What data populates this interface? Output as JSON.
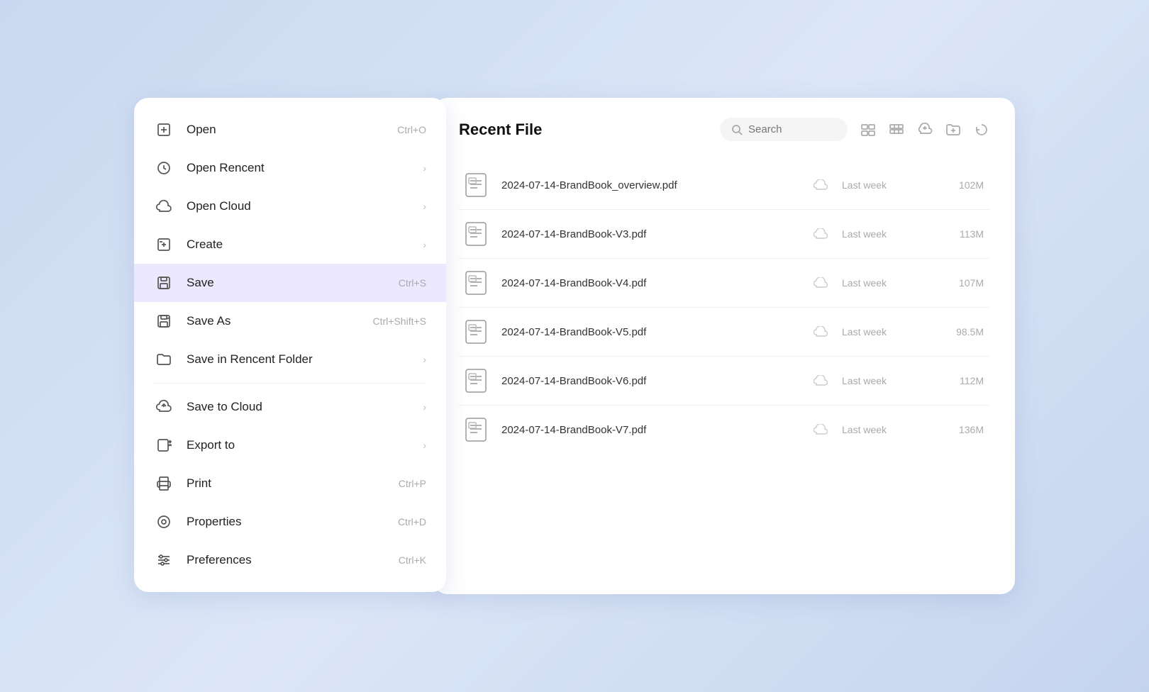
{
  "menu": {
    "items": [
      {
        "id": "open",
        "label": "Open",
        "shortcut": "Ctrl+O",
        "icon": "open-icon",
        "hasArrow": false,
        "active": false
      },
      {
        "id": "open-recent",
        "label": "Open Rencent",
        "shortcut": "",
        "icon": "recent-icon",
        "hasArrow": true,
        "active": false
      },
      {
        "id": "open-cloud",
        "label": "Open Cloud",
        "shortcut": "",
        "icon": "cloud-icon",
        "hasArrow": true,
        "active": false
      },
      {
        "id": "create",
        "label": "Create",
        "shortcut": "",
        "icon": "create-icon",
        "hasArrow": true,
        "active": false
      },
      {
        "id": "save",
        "label": "Save",
        "shortcut": "Ctrl+S",
        "icon": "save-icon",
        "hasArrow": false,
        "active": true
      },
      {
        "id": "save-as",
        "label": "Save As",
        "shortcut": "Ctrl+Shift+S",
        "icon": "save-as-icon",
        "hasArrow": false,
        "active": false
      },
      {
        "id": "save-in-recent",
        "label": "Save in Rencent Folder",
        "shortcut": "",
        "icon": "folder-icon",
        "hasArrow": true,
        "active": false
      },
      {
        "id": "save-to-cloud",
        "label": "Save to Cloud",
        "shortcut": "",
        "icon": "save-cloud-icon",
        "hasArrow": true,
        "active": false
      },
      {
        "id": "export-to",
        "label": "Export to",
        "shortcut": "",
        "icon": "export-icon",
        "hasArrow": true,
        "active": false
      },
      {
        "id": "print",
        "label": "Print",
        "shortcut": "Ctrl+P",
        "icon": "print-icon",
        "hasArrow": false,
        "active": false
      },
      {
        "id": "properties",
        "label": "Properties",
        "shortcut": "Ctrl+D",
        "icon": "properties-icon",
        "hasArrow": false,
        "active": false
      },
      {
        "id": "preferences",
        "label": "Preferences",
        "shortcut": "Ctrl+K",
        "icon": "preferences-icon",
        "hasArrow": false,
        "active": false
      }
    ]
  },
  "filePanel": {
    "title": "Recent File",
    "search": {
      "placeholder": "Search"
    },
    "files": [
      {
        "name": "2024-07-14-BrandBook_overview.pdf",
        "date": "Last week",
        "size": "102M"
      },
      {
        "name": "2024-07-14-BrandBook-V3.pdf",
        "date": "Last week",
        "size": "113M"
      },
      {
        "name": "2024-07-14-BrandBook-V4.pdf",
        "date": "Last week",
        "size": "107M"
      },
      {
        "name": "2024-07-14-BrandBook-V5.pdf",
        "date": "Last week",
        "size": "98.5M"
      },
      {
        "name": "2024-07-14-BrandBook-V6.pdf",
        "date": "Last week",
        "size": "112M"
      },
      {
        "name": "2024-07-14-BrandBook-V7.pdf",
        "date": "Last week",
        "size": "136M"
      }
    ]
  }
}
